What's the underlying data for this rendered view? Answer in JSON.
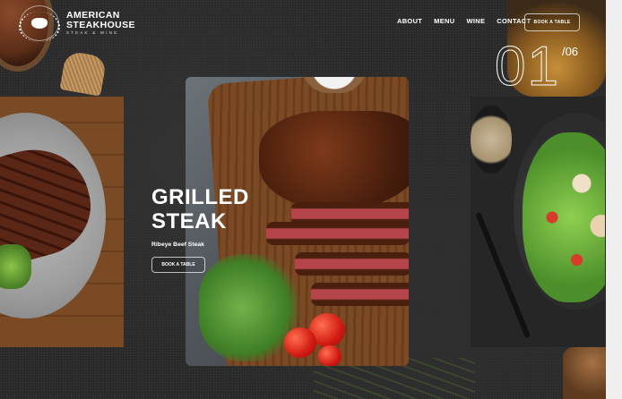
{
  "brand": {
    "name_line1": "AMERICAN",
    "name_line2": "STEAKHOUSE",
    "tagline": "STEAK & WINE",
    "logo_icon": "bull-crest-icon"
  },
  "nav": {
    "items": [
      {
        "label": "ABOUT"
      },
      {
        "label": "MENU"
      },
      {
        "label": "WINE"
      },
      {
        "label": "CONTACT"
      }
    ],
    "book_button": "BOOK A TABLE"
  },
  "slider": {
    "current": "01",
    "total": "/06"
  },
  "hero": {
    "title_line1": "GRILLED",
    "title_line2": "STEAK",
    "subtitle": "Ribeye Beef Steak",
    "button": "BOOK A TABLE"
  },
  "colors": {
    "background": "#2a2a2a",
    "text": "#ffffff",
    "wood": "#7a4a24"
  }
}
